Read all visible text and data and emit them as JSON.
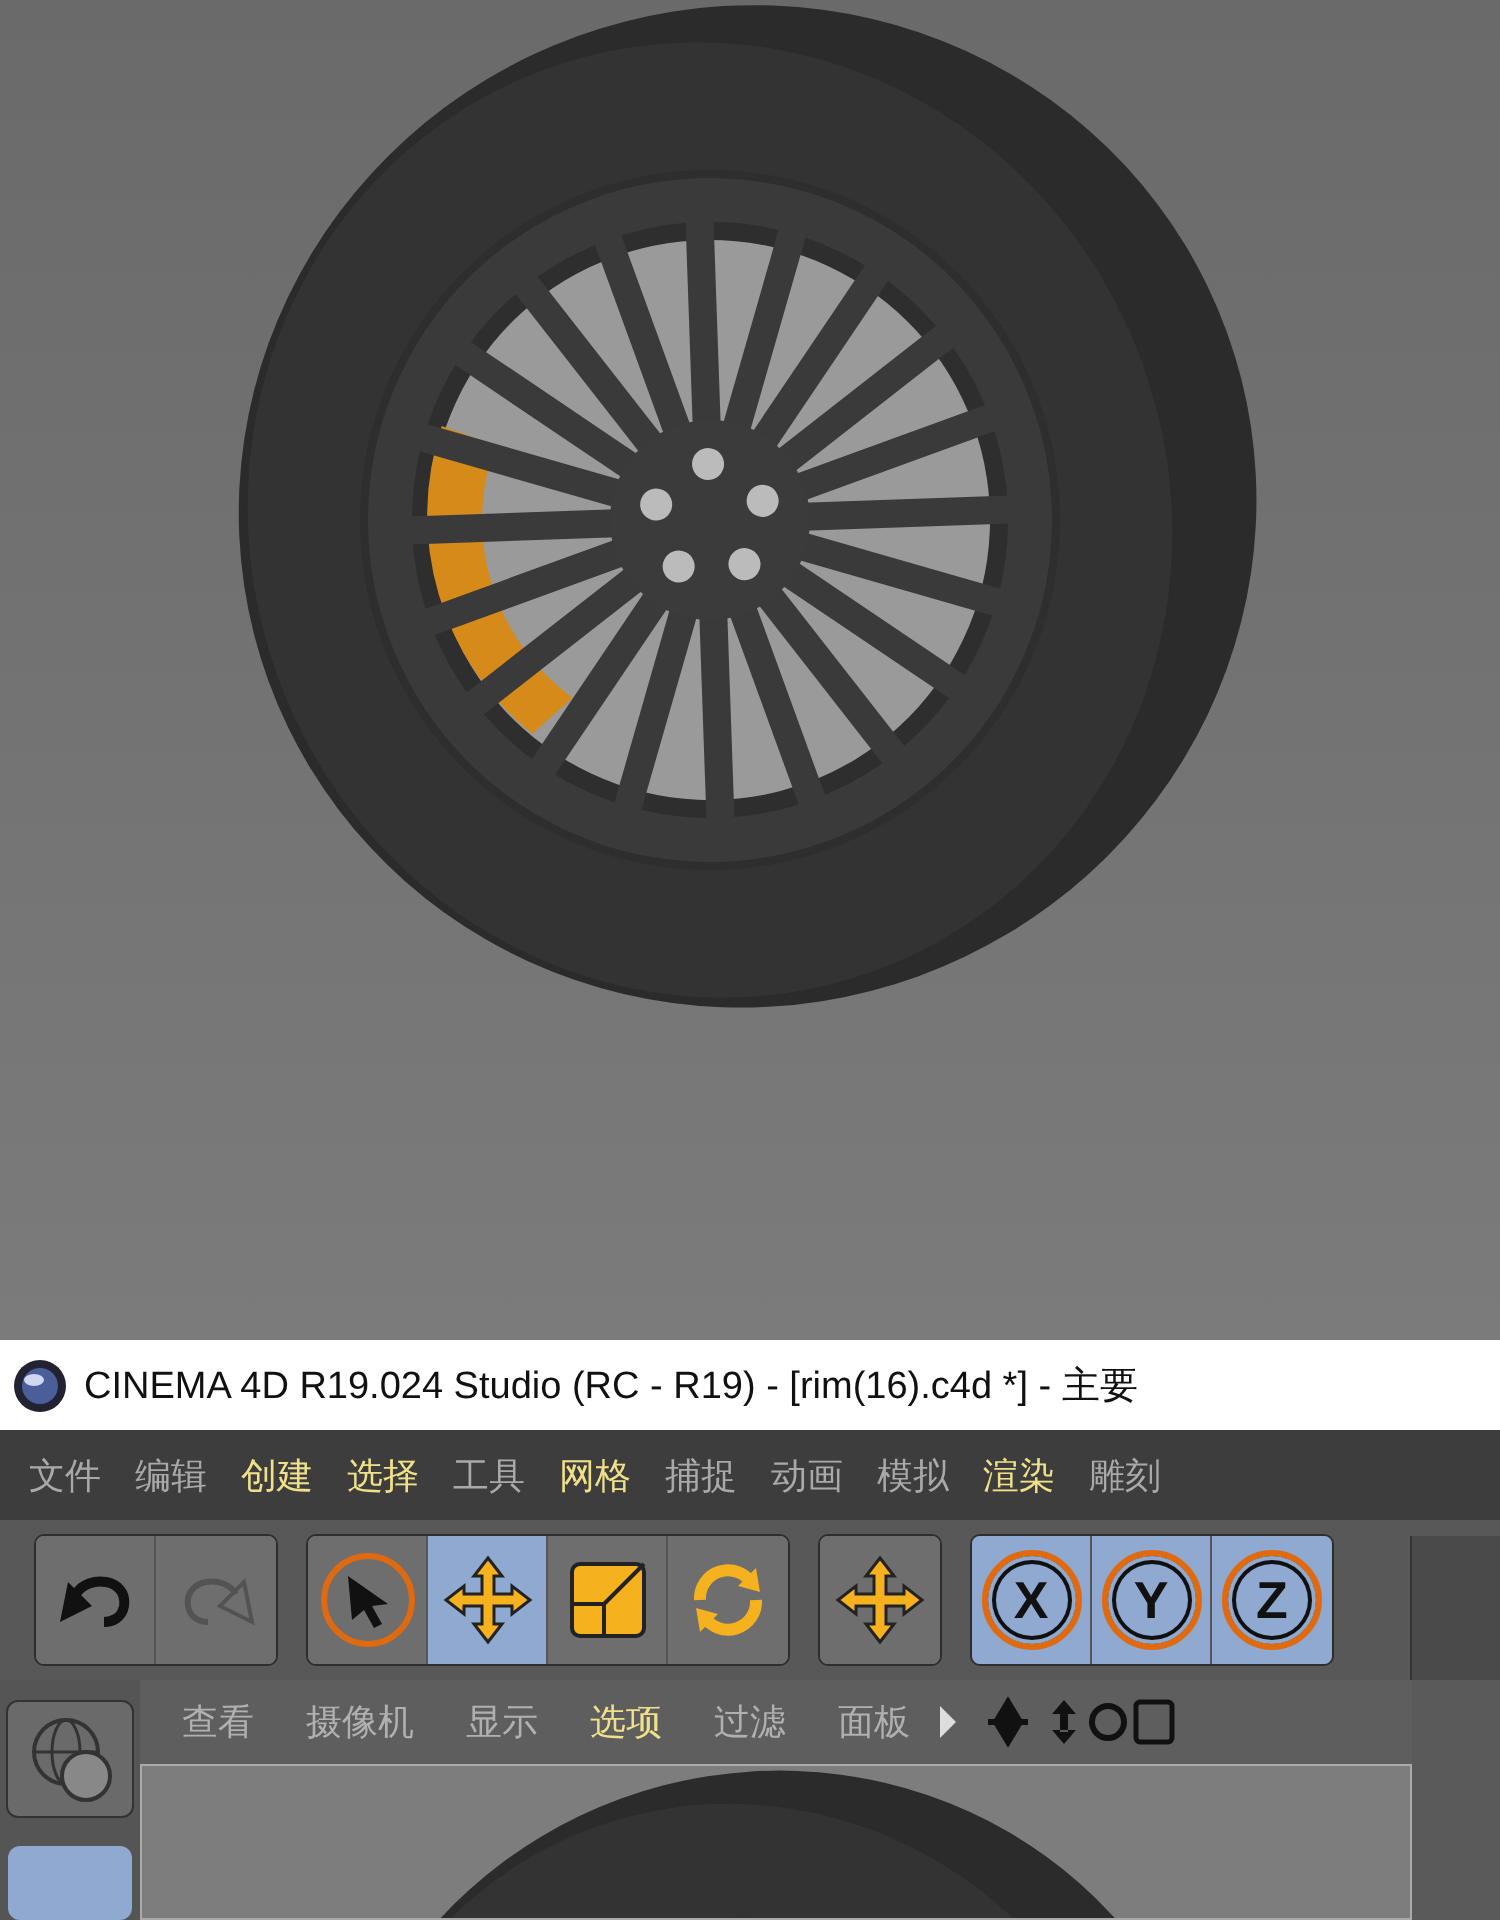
{
  "window": {
    "title": "CINEMA 4D R19.024 Studio (RC - R19) - [rim(16).c4d *] - 主要"
  },
  "menu": [
    {
      "label": "文件",
      "highlighted": false
    },
    {
      "label": "编辑",
      "highlighted": false
    },
    {
      "label": "创建",
      "highlighted": true
    },
    {
      "label": "选择",
      "highlighted": true
    },
    {
      "label": "工具",
      "highlighted": false
    },
    {
      "label": "网格",
      "highlighted": true
    },
    {
      "label": "捕捉",
      "highlighted": false
    },
    {
      "label": "动画",
      "highlighted": false
    },
    {
      "label": "模拟",
      "highlighted": false
    },
    {
      "label": "渲染",
      "highlighted": true
    },
    {
      "label": "雕刻",
      "highlighted": false
    }
  ],
  "toolbar": [
    {
      "tools": [
        {
          "kind": "undo",
          "selected": false,
          "disabled": false
        },
        {
          "kind": "redo",
          "selected": false,
          "disabled": true
        }
      ]
    },
    {
      "tools": [
        {
          "kind": "select",
          "selected": false,
          "disabled": false
        },
        {
          "kind": "move",
          "selected": true,
          "disabled": false
        },
        {
          "kind": "scale",
          "selected": false,
          "disabled": false
        },
        {
          "kind": "rotate",
          "selected": false,
          "disabled": false
        }
      ]
    },
    {
      "tools": [
        {
          "kind": "move",
          "selected": false,
          "disabled": false
        }
      ]
    },
    {
      "tools": [
        {
          "kind": "axis",
          "label": "X",
          "selected": true,
          "disabled": false
        },
        {
          "kind": "axis",
          "label": "Y",
          "selected": true,
          "disabled": false
        },
        {
          "kind": "axis",
          "label": "Z",
          "selected": true,
          "disabled": false
        }
      ]
    }
  ],
  "viewport": {
    "menu": [
      {
        "label": "查看",
        "highlighted": false
      },
      {
        "label": "摄像机",
        "highlighted": false
      },
      {
        "label": "显示",
        "highlighted": false
      },
      {
        "label": "选项",
        "highlighted": true
      },
      {
        "label": "过滤",
        "highlighted": false
      },
      {
        "label": "面板",
        "highlighted": false
      }
    ]
  }
}
